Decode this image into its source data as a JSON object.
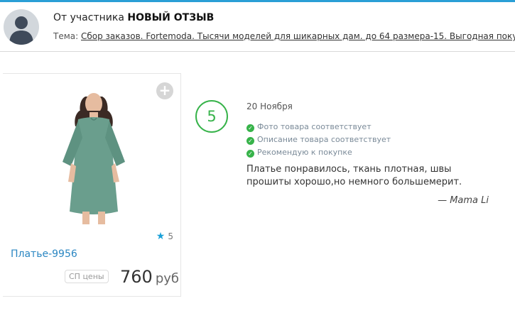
{
  "colors": {
    "accent": "#2a9fd6",
    "link": "#2a86c2",
    "score": "#37b34a",
    "star": "#1aa0d8"
  },
  "header": {
    "title_prefix": "От участника",
    "title_strong": "НОВЫЙ ОТЗЫВ",
    "topic_label": "Тема:",
    "topic_link": "Сбор заказов. Fortemoda. Тысячи моделей для шикарных дам. до 64 размера-15. Выгодная покупка"
  },
  "product": {
    "name": "Платье-9956",
    "rating": "5",
    "sp_label": "СП цены",
    "price": "760",
    "currency": "руб",
    "add_icon": "plus-icon",
    "star_icon": "star-icon"
  },
  "review": {
    "score": "5",
    "date": "20 Ноября",
    "checks": [
      "Фото товара соответствует",
      "Описание товара соответствует",
      "Рекомендую к покупке"
    ],
    "text": "Платье понравилось, ткань плотная, швы прошиты хорошо,но немного большемерит.",
    "author": "— Mama Li"
  }
}
